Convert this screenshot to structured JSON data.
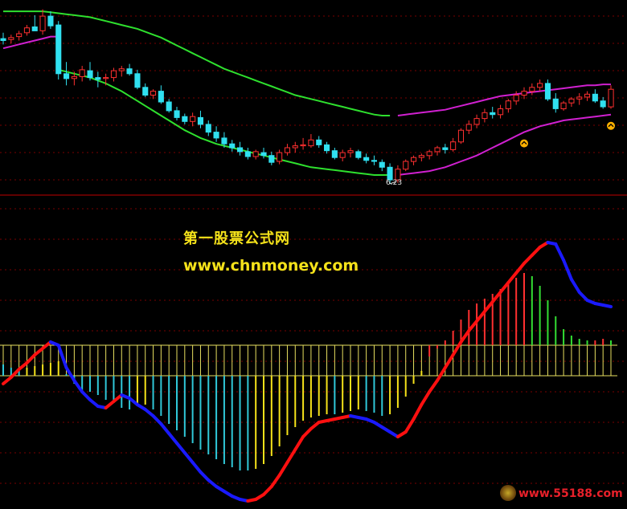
{
  "chart_data": [
    {
      "type": "candlestick",
      "panel": "price",
      "annotations": [
        "6.23"
      ],
      "candles": [
        {
          "o": 7.72,
          "h": 7.78,
          "l": 7.66,
          "c": 7.7
        },
        {
          "o": 7.71,
          "h": 7.76,
          "l": 7.67,
          "c": 7.73
        },
        {
          "o": 7.74,
          "h": 7.8,
          "l": 7.7,
          "c": 7.77
        },
        {
          "o": 7.78,
          "h": 7.86,
          "l": 7.75,
          "c": 7.83
        },
        {
          "o": 7.84,
          "h": 7.96,
          "l": 7.8,
          "c": 7.8
        },
        {
          "o": 7.8,
          "h": 8.02,
          "l": 7.76,
          "c": 7.95
        },
        {
          "o": 7.95,
          "h": 8.0,
          "l": 7.82,
          "c": 7.85
        },
        {
          "o": 7.86,
          "h": 7.9,
          "l": 7.3,
          "c": 7.36
        },
        {
          "o": 7.36,
          "h": 7.48,
          "l": 7.24,
          "c": 7.31
        },
        {
          "o": 7.31,
          "h": 7.38,
          "l": 7.24,
          "c": 7.33
        },
        {
          "o": 7.33,
          "h": 7.44,
          "l": 7.28,
          "c": 7.4
        },
        {
          "o": 7.39,
          "h": 7.48,
          "l": 7.29,
          "c": 7.32
        },
        {
          "o": 7.32,
          "h": 7.38,
          "l": 7.22,
          "c": 7.3
        },
        {
          "o": 7.31,
          "h": 7.36,
          "l": 7.24,
          "c": 7.32
        },
        {
          "o": 7.32,
          "h": 7.42,
          "l": 7.28,
          "c": 7.39
        },
        {
          "o": 7.39,
          "h": 7.44,
          "l": 7.33,
          "c": 7.41
        },
        {
          "o": 7.41,
          "h": 7.46,
          "l": 7.34,
          "c": 7.36
        },
        {
          "o": 7.36,
          "h": 7.4,
          "l": 7.2,
          "c": 7.22
        },
        {
          "o": 7.22,
          "h": 7.26,
          "l": 7.12,
          "c": 7.14
        },
        {
          "o": 7.14,
          "h": 7.2,
          "l": 7.1,
          "c": 7.18
        },
        {
          "o": 7.18,
          "h": 7.24,
          "l": 7.05,
          "c": 7.07
        },
        {
          "o": 7.07,
          "h": 7.1,
          "l": 6.96,
          "c": 6.98
        },
        {
          "o": 6.98,
          "h": 7.02,
          "l": 6.88,
          "c": 6.91
        },
        {
          "o": 6.92,
          "h": 6.95,
          "l": 6.84,
          "c": 6.87
        },
        {
          "o": 6.87,
          "h": 6.96,
          "l": 6.82,
          "c": 6.92
        },
        {
          "o": 6.91,
          "h": 6.98,
          "l": 6.8,
          "c": 6.84
        },
        {
          "o": 6.84,
          "h": 6.88,
          "l": 6.72,
          "c": 6.76
        },
        {
          "o": 6.76,
          "h": 6.82,
          "l": 6.66,
          "c": 6.7
        },
        {
          "o": 6.7,
          "h": 6.76,
          "l": 6.6,
          "c": 6.64
        },
        {
          "o": 6.64,
          "h": 6.68,
          "l": 6.56,
          "c": 6.6
        },
        {
          "o": 6.6,
          "h": 6.66,
          "l": 6.52,
          "c": 6.56
        },
        {
          "o": 6.56,
          "h": 6.6,
          "l": 6.48,
          "c": 6.51
        },
        {
          "o": 6.51,
          "h": 6.58,
          "l": 6.48,
          "c": 6.56
        },
        {
          "o": 6.55,
          "h": 6.6,
          "l": 6.49,
          "c": 6.52
        },
        {
          "o": 6.52,
          "h": 6.56,
          "l": 6.42,
          "c": 6.45
        },
        {
          "o": 6.46,
          "h": 6.58,
          "l": 6.43,
          "c": 6.55
        },
        {
          "o": 6.55,
          "h": 6.64,
          "l": 6.52,
          "c": 6.6
        },
        {
          "o": 6.6,
          "h": 6.66,
          "l": 6.55,
          "c": 6.62
        },
        {
          "o": 6.62,
          "h": 6.7,
          "l": 6.58,
          "c": 6.63
        },
        {
          "o": 6.62,
          "h": 6.74,
          "l": 6.6,
          "c": 6.68
        },
        {
          "o": 6.68,
          "h": 6.72,
          "l": 6.6,
          "c": 6.63
        },
        {
          "o": 6.63,
          "h": 6.66,
          "l": 6.54,
          "c": 6.57
        },
        {
          "o": 6.57,
          "h": 6.6,
          "l": 6.48,
          "c": 6.5
        },
        {
          "o": 6.5,
          "h": 6.58,
          "l": 6.46,
          "c": 6.55
        },
        {
          "o": 6.55,
          "h": 6.6,
          "l": 6.5,
          "c": 6.57
        },
        {
          "o": 6.56,
          "h": 6.58,
          "l": 6.48,
          "c": 6.5
        },
        {
          "o": 6.5,
          "h": 6.54,
          "l": 6.44,
          "c": 6.47
        },
        {
          "o": 6.47,
          "h": 6.52,
          "l": 6.42,
          "c": 6.46
        },
        {
          "o": 6.45,
          "h": 6.48,
          "l": 6.36,
          "c": 6.4
        },
        {
          "o": 6.4,
          "h": 6.44,
          "l": 6.23,
          "c": 6.27
        },
        {
          "o": 6.27,
          "h": 6.42,
          "l": 6.24,
          "c": 6.38
        },
        {
          "o": 6.38,
          "h": 6.48,
          "l": 6.36,
          "c": 6.46
        },
        {
          "o": 6.46,
          "h": 6.52,
          "l": 6.42,
          "c": 6.5
        },
        {
          "o": 6.5,
          "h": 6.54,
          "l": 6.46,
          "c": 6.52
        },
        {
          "o": 6.52,
          "h": 6.58,
          "l": 6.48,
          "c": 6.56
        },
        {
          "o": 6.56,
          "h": 6.62,
          "l": 6.52,
          "c": 6.6
        },
        {
          "o": 6.6,
          "h": 6.64,
          "l": 6.54,
          "c": 6.58
        },
        {
          "o": 6.58,
          "h": 6.7,
          "l": 6.56,
          "c": 6.66
        },
        {
          "o": 6.66,
          "h": 6.8,
          "l": 6.64,
          "c": 6.78
        },
        {
          "o": 6.78,
          "h": 6.88,
          "l": 6.74,
          "c": 6.84
        },
        {
          "o": 6.84,
          "h": 6.94,
          "l": 6.8,
          "c": 6.9
        },
        {
          "o": 6.9,
          "h": 7.0,
          "l": 6.86,
          "c": 6.96
        },
        {
          "o": 6.96,
          "h": 7.02,
          "l": 6.9,
          "c": 6.94
        },
        {
          "o": 6.94,
          "h": 7.04,
          "l": 6.9,
          "c": 7.0
        },
        {
          "o": 7.0,
          "h": 7.1,
          "l": 6.96,
          "c": 7.08
        },
        {
          "o": 7.08,
          "h": 7.18,
          "l": 7.04,
          "c": 7.14
        },
        {
          "o": 7.14,
          "h": 7.22,
          "l": 7.1,
          "c": 7.18
        },
        {
          "o": 7.18,
          "h": 7.26,
          "l": 7.14,
          "c": 7.22
        },
        {
          "o": 7.22,
          "h": 7.3,
          "l": 7.18,
          "c": 7.26
        },
        {
          "o": 7.26,
          "h": 7.3,
          "l": 7.08,
          "c": 7.1
        },
        {
          "o": 7.1,
          "h": 7.16,
          "l": 6.96,
          "c": 7.0
        },
        {
          "o": 7.0,
          "h": 7.08,
          "l": 6.98,
          "c": 7.06
        },
        {
          "o": 7.06,
          "h": 7.12,
          "l": 7.02,
          "c": 7.1
        },
        {
          "o": 7.1,
          "h": 7.16,
          "l": 7.04,
          "c": 7.12
        },
        {
          "o": 7.12,
          "h": 7.18,
          "l": 7.08,
          "c": 7.15
        },
        {
          "o": 7.15,
          "h": 7.2,
          "l": 7.06,
          "c": 7.08
        },
        {
          "o": 7.08,
          "h": 7.12,
          "l": 7.0,
          "c": 7.02
        },
        {
          "o": 7.02,
          "h": 7.24,
          "l": 7.0,
          "c": 7.2
        }
      ],
      "bands": [
        {
          "name": "",
          "color": "#d020d0",
          "values": [
            7.62,
            7.64,
            7.66,
            7.68,
            7.7,
            7.72,
            7.74,
            7.74,
            null,
            null,
            null,
            null,
            null,
            null,
            null,
            null,
            null,
            null,
            null,
            null,
            null,
            null,
            null,
            null,
            null,
            null,
            null,
            null,
            null,
            null,
            null,
            null,
            null,
            null,
            null,
            null,
            null,
            null,
            null,
            null,
            null,
            null,
            null,
            null,
            null,
            null,
            null,
            null,
            null,
            null,
            null,
            null,
            null,
            null,
            null,
            null,
            null,
            null,
            null,
            null,
            null,
            null,
            null,
            null,
            null,
            null,
            null,
            null,
            null,
            null,
            null,
            null,
            null,
            null,
            null,
            null,
            null,
            null
          ]
        },
        {
          "name": "",
          "color": "#2ee02e",
          "values": [
            8.0,
            8.0,
            8.0,
            8.0,
            8.0,
            8.0,
            7.99,
            7.98,
            7.97,
            7.96,
            7.95,
            7.94,
            7.92,
            7.9,
            7.88,
            7.86,
            7.84,
            7.82,
            7.79,
            7.76,
            7.73,
            7.69,
            7.65,
            7.61,
            7.57,
            7.53,
            7.49,
            7.45,
            7.41,
            7.38,
            7.35,
            7.32,
            7.29,
            7.26,
            7.23,
            7.2,
            7.17,
            7.14,
            7.12,
            7.1,
            7.08,
            7.06,
            7.04,
            7.02,
            7.0,
            6.98,
            6.96,
            6.94,
            6.93,
            6.93,
            null,
            null,
            null,
            null,
            null,
            null,
            null,
            null,
            null,
            null,
            null,
            null,
            null,
            null,
            null,
            null,
            null,
            null,
            null,
            null,
            null,
            null,
            null,
            null,
            null,
            null,
            null,
            null
          ]
        },
        {
          "name": "",
          "color": "#2ee02e",
          "values": [
            null,
            null,
            null,
            null,
            null,
            null,
            null,
            7.4,
            7.38,
            7.36,
            7.34,
            7.32,
            7.29,
            7.26,
            7.22,
            7.18,
            7.13,
            7.08,
            7.03,
            6.98,
            6.93,
            6.88,
            6.83,
            6.78,
            6.74,
            6.7,
            6.67,
            6.64,
            6.62,
            6.6,
            6.58,
            6.56,
            6.54,
            6.52,
            6.5,
            6.48,
            6.46,
            6.44,
            6.42,
            6.4,
            6.39,
            6.38,
            6.37,
            6.36,
            6.35,
            6.34,
            6.33,
            6.32,
            6.32,
            6.32,
            null,
            null,
            null,
            null,
            null,
            null,
            null,
            null,
            null,
            null,
            null,
            null,
            null,
            null,
            null,
            null,
            null,
            null,
            null,
            null,
            null,
            null,
            null,
            null,
            null,
            null,
            null,
            null
          ]
        },
        {
          "name": "",
          "color": "#d020d0",
          "values": [
            null,
            null,
            null,
            null,
            null,
            null,
            null,
            null,
            null,
            null,
            null,
            null,
            null,
            null,
            null,
            null,
            null,
            null,
            null,
            null,
            null,
            null,
            null,
            null,
            null,
            null,
            null,
            null,
            null,
            null,
            null,
            null,
            null,
            null,
            null,
            null,
            null,
            null,
            null,
            null,
            null,
            null,
            null,
            null,
            null,
            null,
            null,
            null,
            null,
            null,
            6.93,
            6.94,
            6.95,
            6.96,
            6.97,
            6.98,
            6.99,
            7.01,
            7.03,
            7.05,
            7.07,
            7.09,
            7.11,
            7.13,
            7.14,
            7.15,
            7.16,
            7.17,
            7.18,
            7.19,
            7.2,
            7.21,
            7.22,
            7.23,
            7.24,
            7.24,
            7.25,
            7.25
          ]
        },
        {
          "name": "",
          "color": "#d020d0",
          "values": [
            null,
            null,
            null,
            null,
            null,
            null,
            null,
            null,
            null,
            null,
            null,
            null,
            null,
            null,
            null,
            null,
            null,
            null,
            null,
            null,
            null,
            null,
            null,
            null,
            null,
            null,
            null,
            null,
            null,
            null,
            null,
            null,
            null,
            null,
            null,
            null,
            null,
            null,
            null,
            null,
            null,
            null,
            null,
            null,
            null,
            null,
            null,
            null,
            null,
            null,
            6.32,
            6.33,
            6.34,
            6.35,
            6.36,
            6.38,
            6.4,
            6.43,
            6.46,
            6.49,
            6.52,
            6.56,
            6.6,
            6.64,
            6.68,
            6.72,
            6.76,
            6.79,
            6.82,
            6.84,
            6.86,
            6.88,
            6.89,
            6.9,
            6.91,
            6.92,
            6.93,
            6.94
          ]
        }
      ],
      "ylim": [
        6.18,
        8.05
      ]
    },
    {
      "type": "bar",
      "panel": "oscillator",
      "annotations": [],
      "histogram": [
        -6,
        -10,
        -12,
        -10,
        -8,
        -6,
        -4,
        -2,
        -18,
        -30,
        -38,
        -40,
        -44,
        -50,
        -54,
        -60,
        -62,
        -58,
        -56,
        -62,
        -70,
        -80,
        -88,
        -96,
        -104,
        -112,
        -118,
        -124,
        -130,
        -134,
        -138,
        -138,
        -136,
        -130,
        -120,
        -108,
        -94,
        -84,
        -76,
        -72,
        -70,
        -68,
        -68,
        -66,
        -64,
        -62,
        -64,
        -66,
        -70,
        -68,
        -60,
        -46,
        -30,
        -14,
        4,
        14,
        24,
        36,
        50,
        62,
        70,
        76,
        82,
        88,
        96,
        102,
        108,
        104,
        92,
        74,
        54,
        38,
        30,
        26,
        24,
        24,
        26,
        24
      ],
      "line": [
        -30,
        -22,
        -12,
        -4,
        6,
        14,
        22,
        18,
        -10,
        -26,
        -40,
        -50,
        -58,
        -60,
        -52,
        -44,
        -48,
        -56,
        -62,
        -70,
        -80,
        -92,
        -104,
        -116,
        -128,
        -140,
        -150,
        -158,
        -164,
        -170,
        -174,
        -176,
        -174,
        -168,
        -158,
        -144,
        -128,
        -112,
        -96,
        -86,
        -78,
        -76,
        -74,
        -72,
        -70,
        -72,
        -74,
        -78,
        -84,
        -90,
        -96,
        -90,
        -74,
        -56,
        -40,
        -26,
        -10,
        6,
        22,
        36,
        48,
        60,
        72,
        84,
        96,
        108,
        120,
        130,
        140,
        146,
        144,
        124,
        100,
        84,
        74,
        70,
        68,
        66
      ],
      "zero": 0,
      "ylim": [
        -180,
        150
      ]
    }
  ],
  "watermarks": {
    "site_cn": "第一股票公式网",
    "site_url": "www.chnmoney.com",
    "corner": "www.55188.com"
  },
  "low_label": "6.23",
  "colors": {
    "background": "#000000",
    "bull_candle": "#ff3030",
    "bear_candle": "#30e0f0",
    "hist_pos": "#ff3030",
    "hist_pos_fall": "#33dd33",
    "hist_neg": "#30c8d8",
    "hist_neg_rise": "#f5e21a",
    "line_up": "#ff1010",
    "line_down": "#1a1aff",
    "zero_box": "#e8e060",
    "grid": "#7a0000",
    "separator": "#c00000",
    "marker": "#ffb000"
  }
}
